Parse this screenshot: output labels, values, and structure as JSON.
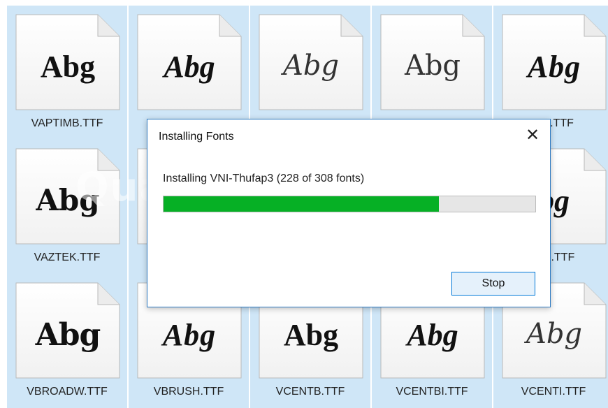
{
  "tiles": [
    {
      "sample": "Abg",
      "label": "VAPTIMB.TTF",
      "style": "f-serif-bold"
    },
    {
      "sample": "Abg",
      "label": "",
      "style": "f-serif-bi"
    },
    {
      "sample": "Abg",
      "label": "",
      "style": "f-serif-lighti"
    },
    {
      "sample": "Abg",
      "label": "",
      "style": "f-serif-light"
    },
    {
      "sample": "Abg",
      "label": "ON.TTF",
      "style": "f-script"
    },
    {
      "sample": "Abg",
      "label": "VAZTEK.TTF",
      "style": "f-stripe"
    },
    {
      "sample": "",
      "label": "",
      "style": "f-serif-bold"
    },
    {
      "sample": "",
      "label": "",
      "style": "f-serif-bold"
    },
    {
      "sample": "",
      "label": "",
      "style": "f-serif-bold"
    },
    {
      "sample": "bg",
      "label": "NBI.TTF",
      "style": "f-serif-bi"
    },
    {
      "sample": "Abg",
      "label": "VBROADW.TTF",
      "style": "f-black"
    },
    {
      "sample": "Abg",
      "label": "VBRUSH.TTF",
      "style": "f-script"
    },
    {
      "sample": "Abg",
      "label": "VCENTB.TTF",
      "style": "f-serif-bold"
    },
    {
      "sample": "Abg",
      "label": "VCENTBI.TTF",
      "style": "f-serif-bi"
    },
    {
      "sample": "Abg",
      "label": "VCENTI.TTF",
      "style": "f-serif-lighti"
    }
  ],
  "dialog": {
    "title": "Installing Fonts",
    "close_glyph": "✕",
    "status": "Installing VNI-Thufap3 (228 of 308 fonts)",
    "progress_done": 228,
    "progress_total": 308,
    "stop_label": "Stop"
  },
  "watermark": "Quantrimang",
  "colors": {
    "tile_bg": "#cfe6f7",
    "progress_fill": "#06b025",
    "dialog_border": "#2b79c2"
  }
}
